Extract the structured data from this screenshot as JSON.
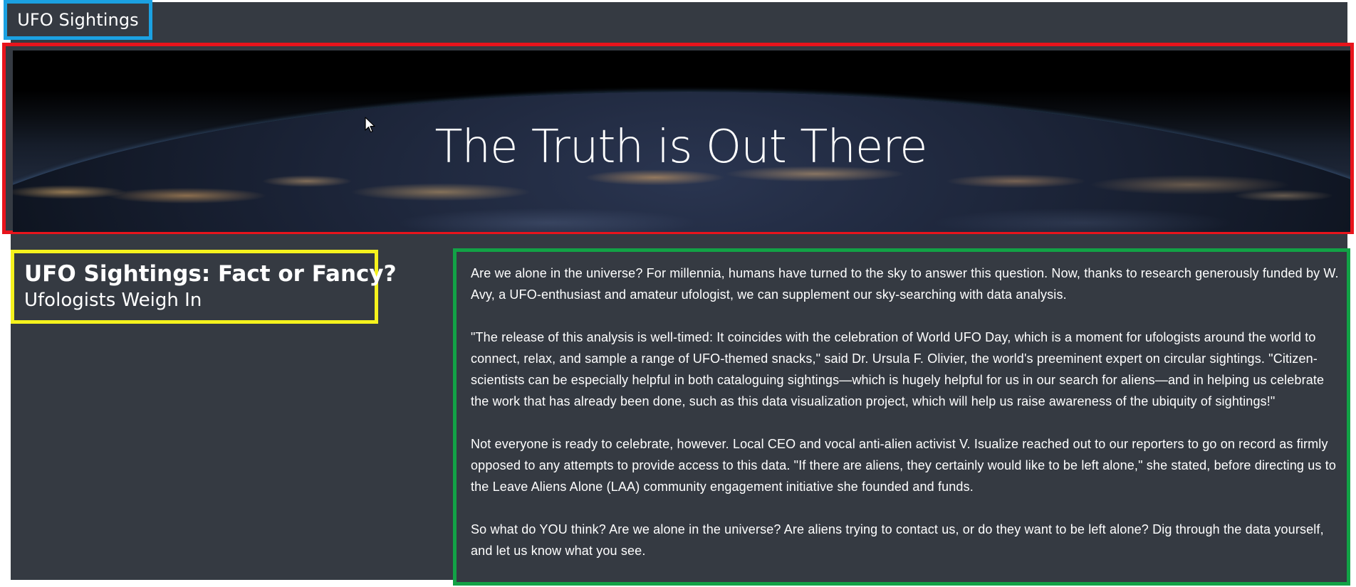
{
  "navbar": {
    "brand": "UFO Sightings"
  },
  "hero": {
    "title": "The Truth is Out There"
  },
  "intro": {
    "title": "UFO Sightings: Fact or Fancy?",
    "subtitle": "Ufologists Weigh In"
  },
  "article": {
    "paragraphs": [
      "Are we alone in the universe? For millennia, humans have turned to the sky to answer this question. Now, thanks to research generously funded by W. Avy, a UFO-enthusiast and amateur ufologist, we can supplement our sky-searching with data analysis.",
      "\"The release of this analysis is well-timed: It coincides with the celebration of World UFO Day, which is a moment for ufologists around the world to connect, relax, and sample a range of UFO-themed snacks,\" said Dr. Ursula F. Olivier, the world's preeminent expert on circular sightings. \"Citizen-scientists can be especially helpful in both cataloguing sightings—which is hugely helpful for us in our search for aliens—and in helping us celebrate the work that has already been done, such as this data visualization project, which will help us raise awareness of the ubiquity of sightings!\"",
      "Not everyone is ready to celebrate, however. Local CEO and vocal anti-alien activist V. Isualize reached out to our reporters to go on record as firmly opposed to any attempts to provide access to this data. \"If there are aliens, they certainly would like to be left alone,\" she stated, before directing us to the Leave Aliens Alone (LAA) community engagement initiative she founded and funds.",
      "So what do YOU think? Are we alone in the universe? Are aliens trying to contact us, or do they want to be left alone? Dig through the data yourself, and let us know what you see."
    ]
  },
  "colors": {
    "page_background": "#353a42",
    "navbar_outline": "#1ba1e2",
    "hero_outline": "#e8141c",
    "heading_outline": "#f5f21d",
    "article_outline": "#12a246",
    "text": "#ffffff"
  },
  "icons": {
    "cursor": "mouse-pointer-icon"
  }
}
